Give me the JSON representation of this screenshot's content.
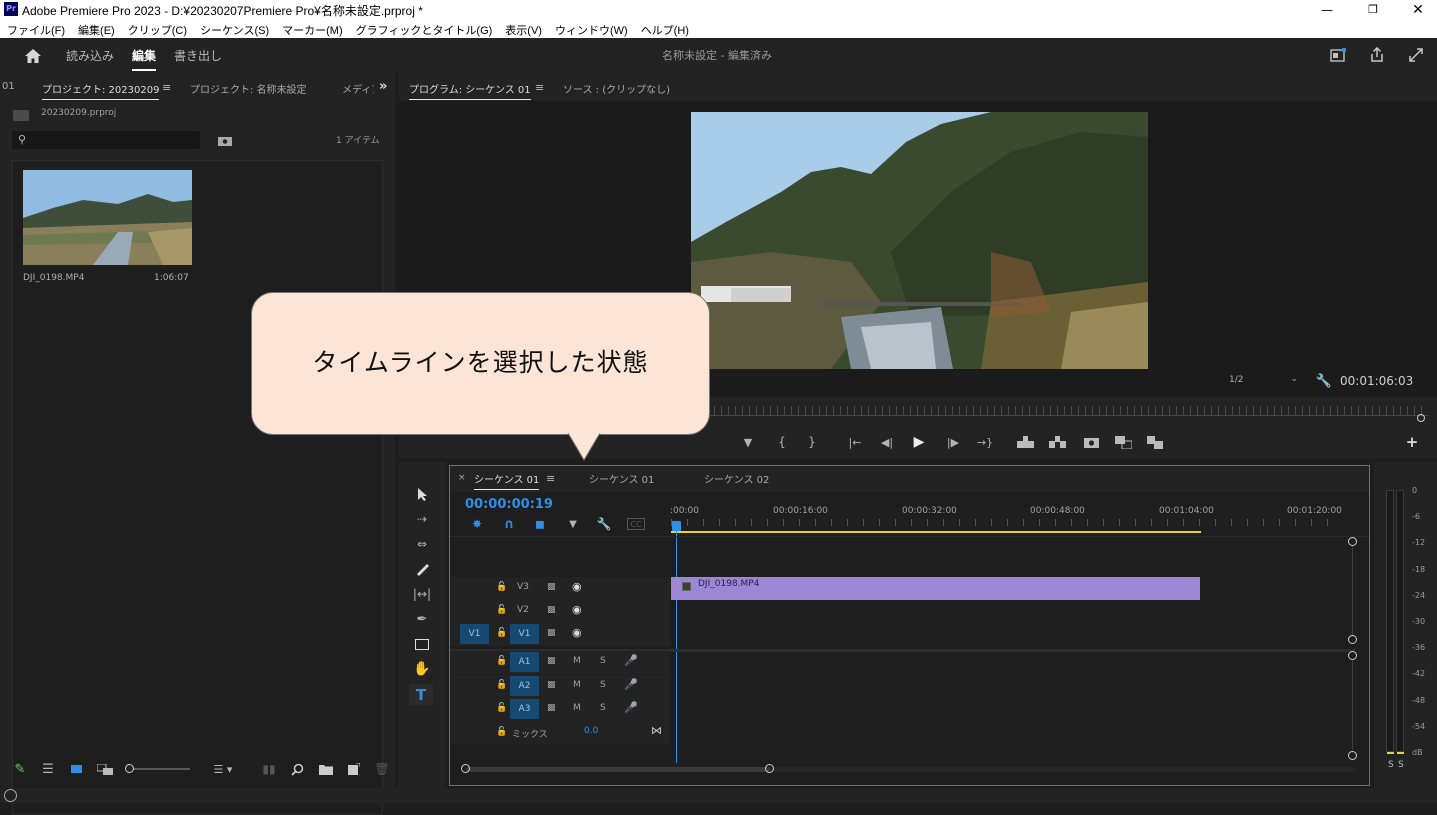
{
  "window": {
    "title": "Adobe Premiere Pro 2023 - D:¥20230207Premiere Pro¥名称未設定.prproj *",
    "app_icon": "Pr"
  },
  "menu": [
    "ファイル(F)",
    "編集(E)",
    "クリップ(C)",
    "シーケンス(S)",
    "マーカー(M)",
    "グラフィックとタイトル(G)",
    "表示(V)",
    "ウィンドウ(W)",
    "ヘルプ(H)"
  ],
  "header": {
    "tabs": [
      "読み込み",
      "編集",
      "書き出し"
    ],
    "active_tab": "編集",
    "project_title": "名称未設定",
    "project_status": " - 編集済み"
  },
  "project_panel": {
    "tabs": [
      "01",
      "プロジェクト: 20230209",
      "プロジェクト: 名称未設定",
      "メディア"
    ],
    "file": "20230209.prproj",
    "item_count": "1 アイテム",
    "search_placeholder": "",
    "clip": {
      "name": "DJI_0198.MP4",
      "duration": "1:06:07"
    }
  },
  "program_monitor": {
    "tabs": [
      "プログラム: シーケンス 01",
      "ソース : (クリップなし)"
    ],
    "resolution": "1/2",
    "timecode": "00:01:06:03"
  },
  "callout": {
    "text": "タイムラインを選択した状態"
  },
  "timeline": {
    "tabs": [
      "シーケンス 01",
      "シーケンス 01",
      "シーケンス 02"
    ],
    "timecode": "00:00:00:19",
    "ruler": [
      ":00:00",
      "00:00:16:00",
      "00:00:32:00",
      "00:00:48:00",
      "00:01:04:00",
      "00:01:20:00"
    ],
    "video_tracks": [
      "V3",
      "V2",
      "V1"
    ],
    "audio_tracks": [
      "A1",
      "A2",
      "A3"
    ],
    "source_patch": "V1",
    "mix_label": "ミックス",
    "mix_value": "0.0",
    "m_label": "M",
    "s_label": "S",
    "clip_name": "DJI_0198.MP4",
    "clip_color": "#9b87d4"
  },
  "audio_meter": {
    "scale": [
      "0",
      "-6",
      "-12",
      "-18",
      "-24",
      "-30",
      "-36",
      "-42",
      "-48",
      "-54",
      "dB"
    ],
    "solo": [
      "S",
      "S"
    ]
  },
  "colors": {
    "accent": "#2f8fe5",
    "work_area": "#e6d72a",
    "selection": "#3b7cc9"
  }
}
